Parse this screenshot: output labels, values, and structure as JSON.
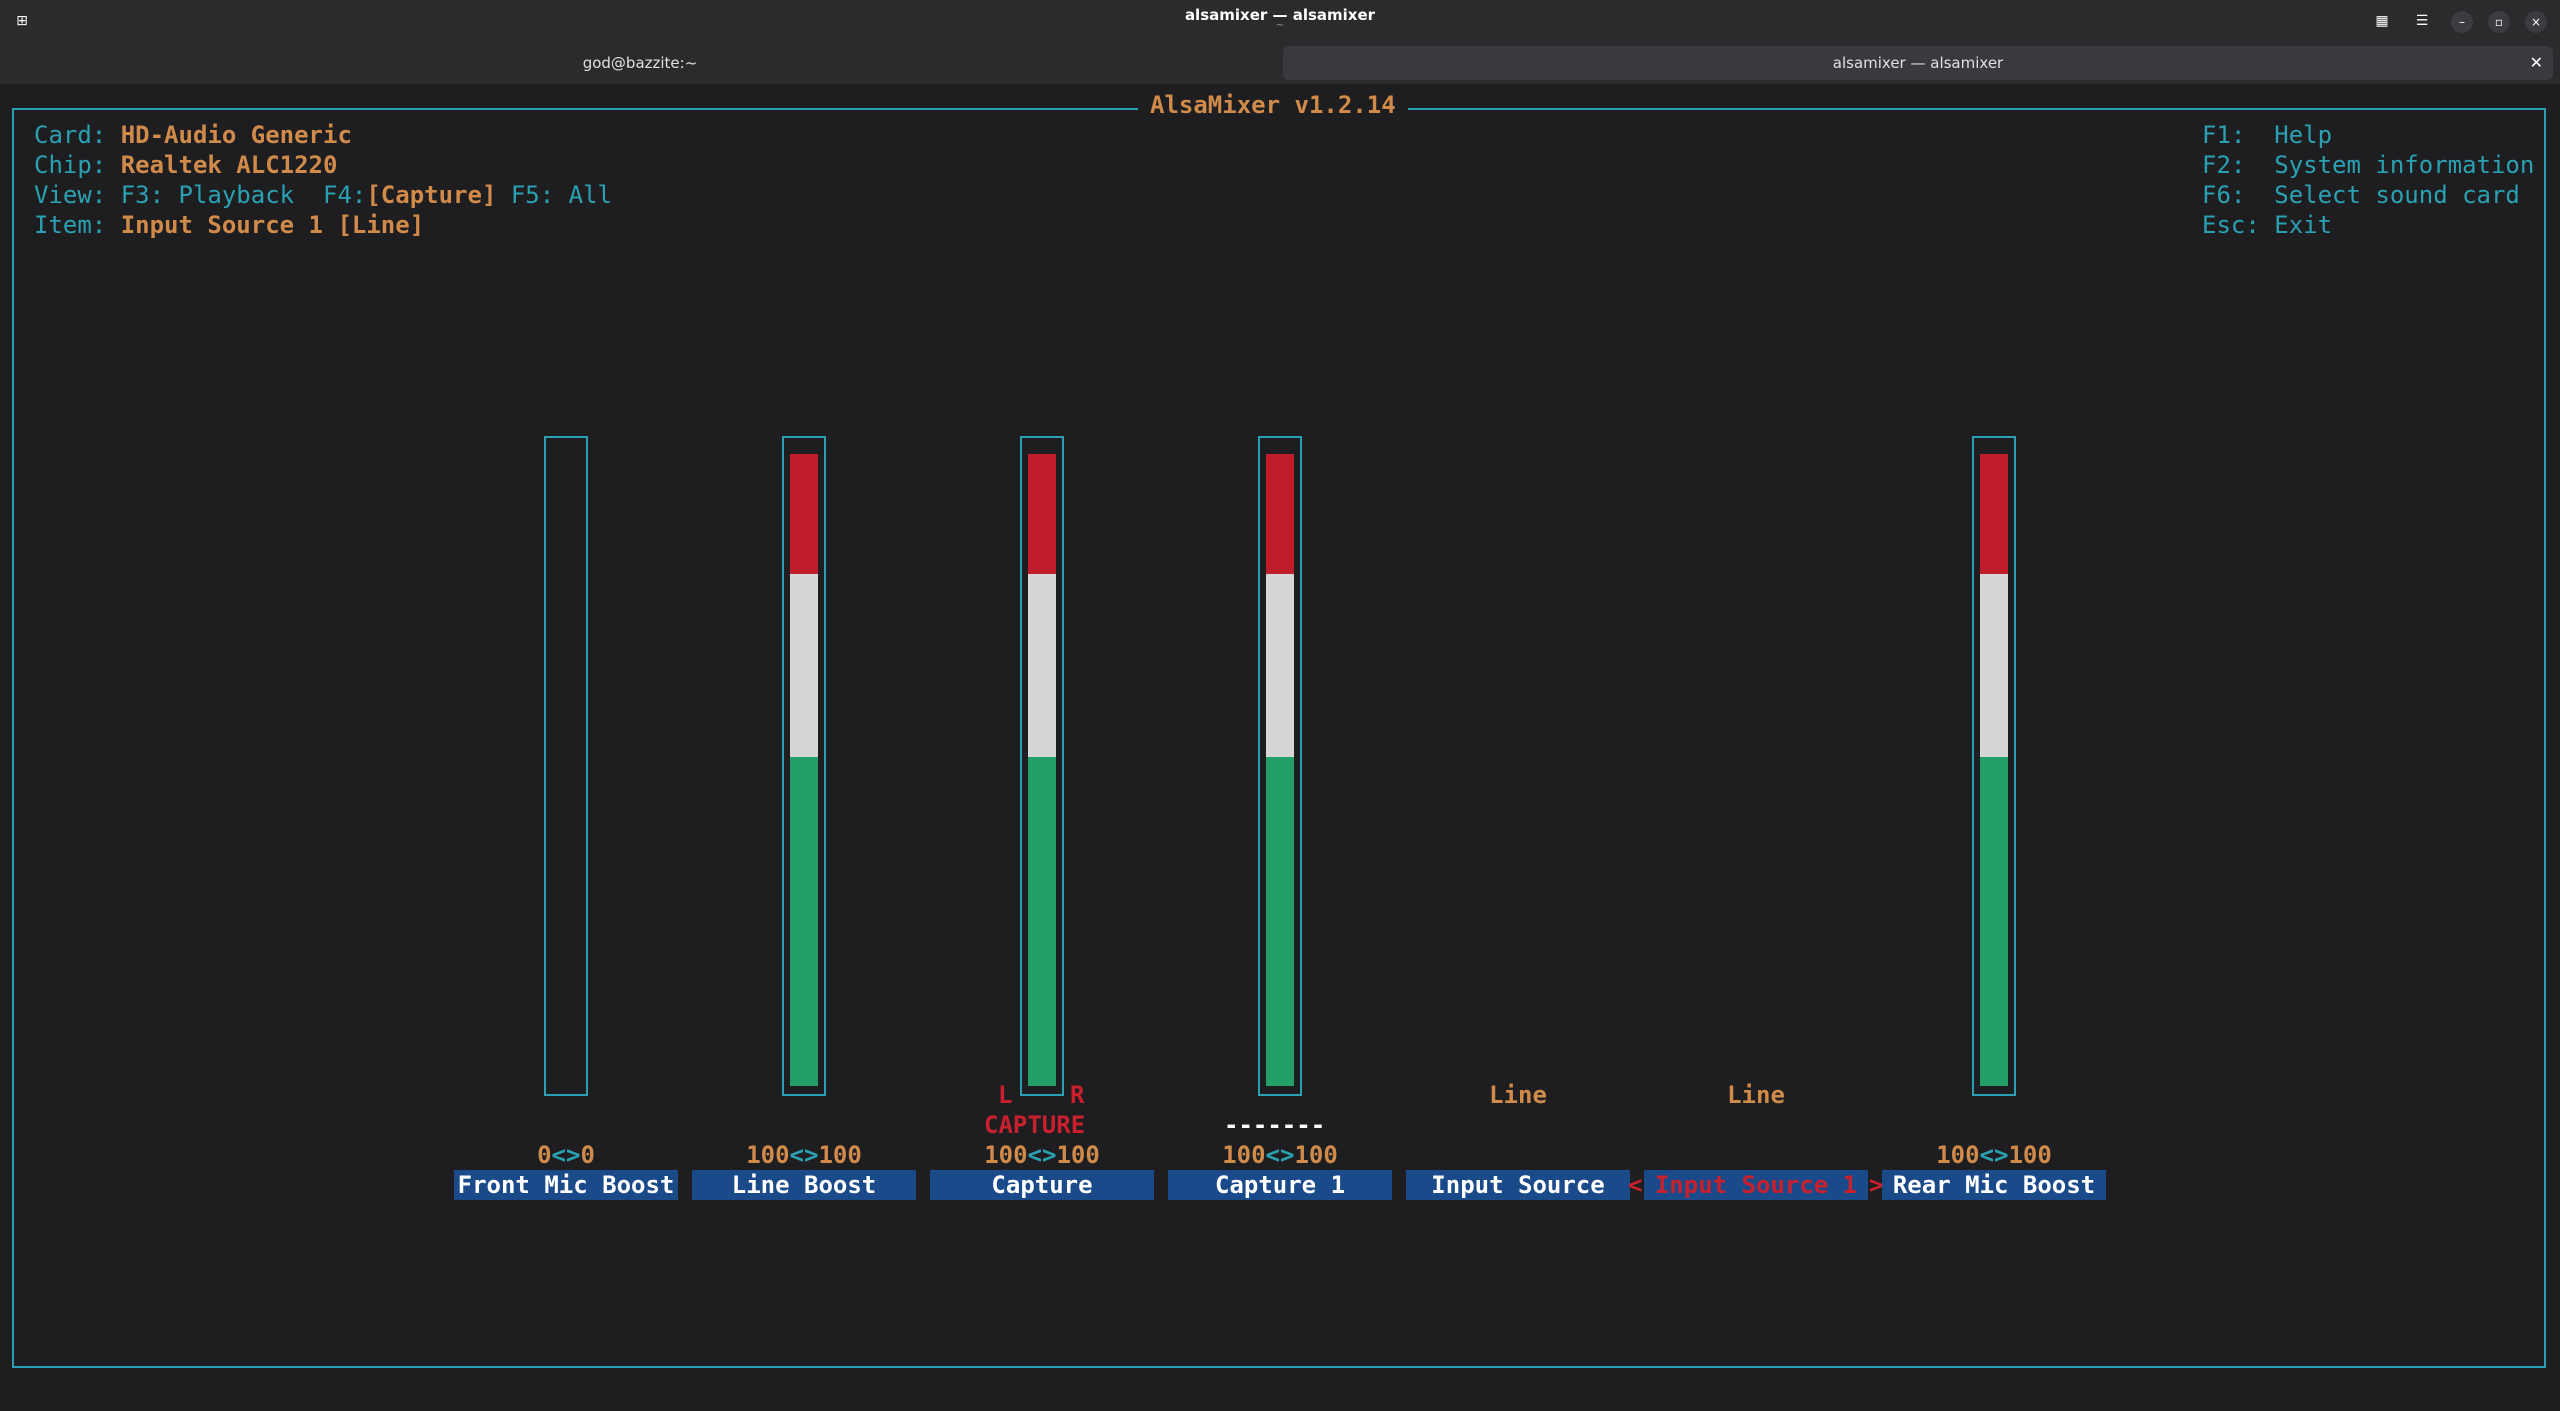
{
  "window": {
    "title": "alsamixer — alsamixer",
    "subtitle": "~"
  },
  "tabs": [
    {
      "label": "god@bazzite:~"
    },
    {
      "label": "alsamixer — alsamixer"
    }
  ],
  "mixer": {
    "title": "AlsaMixer v1.2.14",
    "card_label": "Card:",
    "card_value": "HD-Audio Generic",
    "chip_label": "Chip:",
    "chip_value": "Realtek ALC1220",
    "view_label": "View:",
    "view_f3": "F3: Playback",
    "view_f4_key": "F4:",
    "view_f4_value": "[Capture]",
    "view_f5": "F5: All",
    "item_label": "Item:",
    "item_value": "Input Source 1 [Line]",
    "help": [
      "F1:  Help",
      "F2:  System information",
      "F6:  Select sound card",
      "Esc: Exit"
    ],
    "controls": [
      {
        "name": "Front Mic Boost",
        "left": "0",
        "sep": "<>",
        "right": "0",
        "level": 0
      },
      {
        "name": "Line Boost",
        "left": "100",
        "sep": "<>",
        "right": "100",
        "level": 100
      },
      {
        "name": "Capture",
        "left": "100",
        "sep": "<>",
        "right": "100",
        "level": 100,
        "ch_left": "L",
        "ch_right": "R",
        "capture_flag": "CAPTURE"
      },
      {
        "name": "Capture 1",
        "left": "100",
        "sep": "<>",
        "right": "100",
        "level": 100,
        "capture_flag": "-------"
      },
      {
        "name": "Input Source",
        "enum": "Line"
      },
      {
        "name": "Input Source 1",
        "enum": "Line",
        "selected": true,
        "sel_left": "<",
        "sel_right": ">"
      },
      {
        "name": "Rear Mic Boost",
        "left": "100",
        "sep": "<>",
        "right": "100",
        "level": 100
      }
    ],
    "colors": {
      "border": "#2aa1b3",
      "label_bg": "#1a4a8a",
      "value": "#d08a4a",
      "meter_green": "#23a068",
      "meter_white": "#d6d6d6",
      "meter_red": "#c01c2a"
    }
  }
}
